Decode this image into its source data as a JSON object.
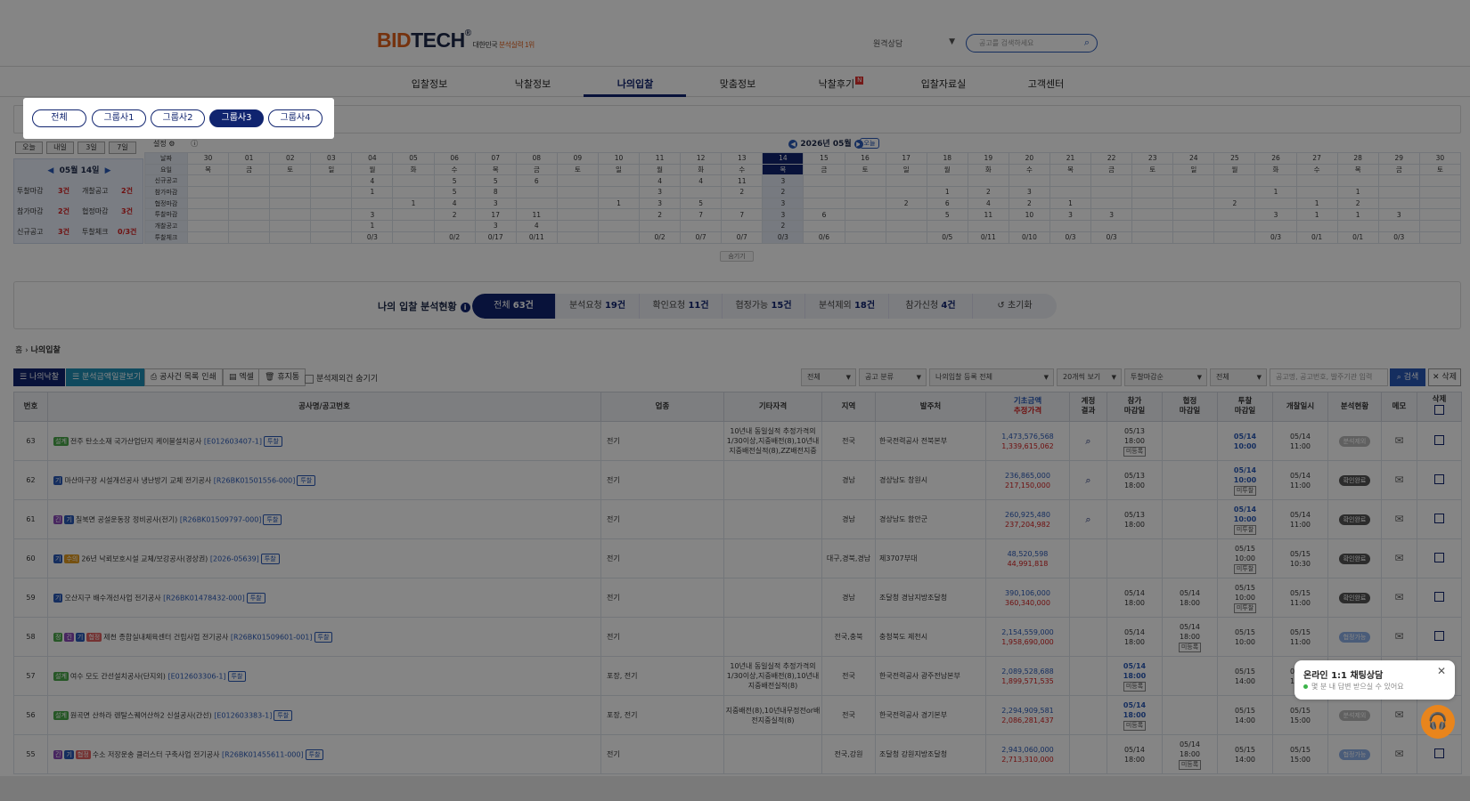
{
  "header": {
    "logo_bid": "BID",
    "logo_tech": "TECH",
    "logo_reg": "®",
    "slogan_prefix": "대한민국",
    "slogan_highlight": "분석실력 1위",
    "remote": "원격상담",
    "search_placeholder": "공고를 검색하세요"
  },
  "nav": [
    "입찰정보",
    "낙찰정보",
    "나의입찰",
    "맞춤정보",
    "낙찰후기",
    "입찰자료실",
    "고객센터"
  ],
  "nav_new_badge": "N",
  "groups": [
    "전체",
    "그룹사1",
    "그룹사2",
    "그룹사3",
    "그룹사4"
  ],
  "quick": [
    "오늘",
    "내일",
    "3일",
    "7일"
  ],
  "left_panel": {
    "date": "05월 14일",
    "rows": [
      {
        "a": "투찰마감",
        "av": "3건",
        "b": "개찰공고",
        "bv": "2건"
      },
      {
        "a": "참가마감",
        "av": "2건",
        "b": "협정마감",
        "bv": "3건"
      },
      {
        "a": "신규공고",
        "av": "3건",
        "b": "투찰체크",
        "bv": "0/3건"
      }
    ]
  },
  "calendar": {
    "setting": "설정",
    "month": "2026년 05월",
    "today_btn": "오늘",
    "row_labels": [
      "날짜",
      "요일",
      "신규공고",
      "참가마감",
      "협정마감",
      "투찰마감",
      "개찰공고",
      "투찰체크"
    ],
    "days": [
      "30",
      "01",
      "02",
      "03",
      "04",
      "05",
      "06",
      "07",
      "08",
      "09",
      "10",
      "11",
      "12",
      "13",
      "14",
      "15",
      "16",
      "17",
      "18",
      "19",
      "20",
      "21",
      "22",
      "23",
      "24",
      "25",
      "26",
      "27",
      "28",
      "29",
      "30"
    ],
    "weekdays": [
      "목",
      "금",
      "토",
      "일",
      "월",
      "화",
      "수",
      "목",
      "금",
      "토",
      "일",
      "월",
      "화",
      "수",
      "목",
      "금",
      "토",
      "일",
      "월",
      "화",
      "수",
      "목",
      "금",
      "토",
      "일",
      "월",
      "화",
      "수",
      "목",
      "금",
      "토"
    ],
    "new": [
      "",
      "",
      "",
      "",
      "4",
      "",
      "5",
      "5",
      "6",
      "",
      "",
      "4",
      "4",
      "11",
      "3",
      "",
      "",
      "",
      "",
      "",
      "",
      "",
      "",
      "",
      "",
      "",
      "",
      "",
      "",
      "",
      ""
    ],
    "join": [
      "",
      "",
      "",
      "",
      "1",
      "",
      "5",
      "8",
      "",
      "",
      "",
      "3",
      "",
      "2",
      "2",
      "",
      "",
      "",
      "1",
      "2",
      "3",
      "",
      "",
      "",
      "",
      "",
      "1",
      "",
      "1",
      "",
      ""
    ],
    "agree": [
      "",
      "",
      "",
      "",
      "",
      "1",
      "4",
      "3",
      "",
      "",
      "1",
      "3",
      "5",
      "",
      "3",
      "",
      "",
      "2",
      "6",
      "4",
      "2",
      "1",
      "",
      "",
      "",
      "2",
      "",
      "1",
      "2",
      "",
      ""
    ],
    "bid": [
      "",
      "",
      "",
      "",
      "3",
      "",
      "2",
      "17",
      "11",
      "",
      "",
      "2",
      "7",
      "7",
      "3",
      "6",
      "",
      "",
      "5",
      "11",
      "10",
      "3",
      "3",
      "",
      "",
      "",
      "3",
      "1",
      "1",
      "3",
      ""
    ],
    "open": [
      "",
      "",
      "",
      "",
      "1",
      "",
      "",
      "3",
      "4",
      "",
      "",
      "",
      "",
      "",
      "2",
      "",
      "",
      "",
      "",
      "",
      "",
      "",
      "",
      "",
      "",
      "",
      "",
      "",
      "",
      "",
      ""
    ],
    "check": [
      "",
      "",
      "",
      "",
      "0/3",
      "",
      "0/2",
      "0/17",
      "0/11",
      "",
      "",
      "0/2",
      "0/7",
      "0/7",
      "0/3",
      "0/6",
      "",
      "",
      "0/5",
      "0/11",
      "0/10",
      "0/3",
      "0/3",
      "",
      "",
      "",
      "0/3",
      "0/1",
      "0/1",
      "0/3",
      ""
    ],
    "collapse": "숨기기"
  },
  "summary": {
    "title": "나의 입찰 분석현황",
    "tabs": [
      {
        "label": "전체",
        "count": "63건"
      },
      {
        "label": "분석요청",
        "count": "19건"
      },
      {
        "label": "확인요청",
        "count": "11건"
      },
      {
        "label": "협정가능",
        "count": "15건"
      },
      {
        "label": "분석제외",
        "count": "18건"
      },
      {
        "label": "참가신청",
        "count": "4건"
      }
    ],
    "reset": "초기화"
  },
  "breadcrumb": {
    "home": "홈",
    "current": "나의입찰"
  },
  "toolbar": {
    "my_bids": "나의낙찰",
    "analysis": "분석금액일괄보기",
    "print": "공사건 목록 인쇄",
    "excel": "엑셀",
    "trash": "휴지통",
    "hide": "분석제외건 숨기기",
    "filters": [
      "전체",
      "공고 분류",
      "나의입찰 등록 전체",
      "20개씩 보기",
      "투찰마감순",
      "전체"
    ],
    "keyword_placeholder": "공고명, 공고번호, 발주기관 입력",
    "search": "검색",
    "delete": "삭제"
  },
  "table": {
    "headers": {
      "no": "번호",
      "name": "공사명/공고번호",
      "industry": "업종",
      "qual": "기타자격",
      "region": "지역",
      "client": "발주처",
      "price1": "기초금액",
      "price2": "추정가격",
      "calc1": "계정",
      "calc2": "결과",
      "join1": "참가",
      "join2": "마감일",
      "agree1": "협정",
      "agree2": "마감일",
      "bid1": "투찰",
      "bid2": "마감일",
      "open": "개찰일시",
      "status": "분석현황",
      "memo": "메모",
      "del": "삭제"
    },
    "rows": [
      {
        "no": "63",
        "tags": [
          [
            "설계",
            "green"
          ]
        ],
        "title": "전주 탄소소재 국가산업단지 케이블설치공사",
        "code": "[E012603407-1]",
        "industry": "전기",
        "qual": "10년내 동일실적 추정가격의 1/30이상,지중배전(8),10년내지중배전실적(8),ZZ배전지중",
        "region": "전국",
        "client": "한국전력공사 전북본부",
        "p1": "1,473,576,568",
        "p2": "1,339,615,062",
        "calc": true,
        "jd": "05/13",
        "jt": "18:00",
        "jr": "미등록",
        "ad": "",
        "at": "",
        "ar": "",
        "bd": "05/14",
        "bt": "10:00",
        "br": "",
        "od": "05/14",
        "ot": "11:00",
        "status": "분석제외",
        "st": "light"
      },
      {
        "no": "62",
        "tags": [
          [
            "기",
            "blue"
          ]
        ],
        "title": "마산마구장 시설개선공사 냉난방기 교체 전기공사",
        "code": "[R26BK01501556-000]",
        "industry": "전기",
        "qual": "",
        "region": "경남",
        "client": "경상남도 창원시",
        "p1": "236,865,000",
        "p2": "217,150,000",
        "calc": true,
        "jd": "05/13",
        "jt": "18:00",
        "jr": "",
        "ad": "",
        "at": "",
        "ar": "",
        "bd": "05/14",
        "bt": "10:00",
        "br": "미투찰",
        "od": "05/14",
        "ot": "11:00",
        "status": "확인완료",
        "st": "dark"
      },
      {
        "no": "61",
        "tags": [
          [
            "긴",
            "purple"
          ],
          [
            "기",
            "blue"
          ]
        ],
        "title": "칠북면 공설운동장 정비공사(전기)",
        "code": "[R26BK01509797-000]",
        "industry": "전기",
        "qual": "",
        "region": "경남",
        "client": "경상남도 함안군",
        "p1": "260,925,480",
        "p2": "237,204,982",
        "calc": true,
        "jd": "05/13",
        "jt": "18:00",
        "jr": "",
        "ad": "",
        "at": "",
        "ar": "",
        "bd": "05/14",
        "bt": "10:00",
        "br": "미투찰",
        "od": "05/14",
        "ot": "11:00",
        "status": "확인완료",
        "st": "dark"
      },
      {
        "no": "60",
        "tags": [
          [
            "기",
            "blue"
          ],
          [
            "수의",
            "orange"
          ]
        ],
        "title": "26년 낙뢰보호시설 교체/보강공사(경상권)",
        "code": "[2026-05639]",
        "industry": "전기",
        "qual": "",
        "region": "대구,경북,경남",
        "client": "제3707부대",
        "p1": "48,520,598",
        "p2": "44,991,818",
        "calc": false,
        "jd": "",
        "jt": "",
        "jr": "",
        "ad": "",
        "at": "",
        "ar": "",
        "bd": "05/15",
        "bt": "10:00",
        "br": "미투찰",
        "od": "05/15",
        "ot": "10:30",
        "status": "확인완료",
        "st": "dark"
      },
      {
        "no": "59",
        "tags": [
          [
            "기",
            "blue"
          ]
        ],
        "title": "오산지구 배수개선사업 전기공사",
        "code": "[R26BK01478432-000]",
        "industry": "전기",
        "qual": "",
        "region": "경남",
        "client": "조달청 경남지방조달청",
        "p1": "390,106,000",
        "p2": "360,340,000",
        "calc": false,
        "jd": "05/14",
        "jt": "18:00",
        "jr": "",
        "ad": "05/14",
        "at": "18:00",
        "ar": "",
        "bd": "05/15",
        "bt": "10:00",
        "br": "미투찰",
        "od": "05/15",
        "ot": "11:00",
        "status": "확인완료",
        "st": "dark"
      },
      {
        "no": "58",
        "tags": [
          [
            "정",
            "green"
          ],
          [
            "긴",
            "purple"
          ],
          [
            "기",
            "blue"
          ],
          [
            "협정",
            "red"
          ]
        ],
        "title": "제천 종합실내체육센터 건립사업 전기공사",
        "code": "[R26BK01509601-001]",
        "industry": "전기",
        "qual": "",
        "region": "전국,충북",
        "client": "충청북도 제천시",
        "p1": "2,154,559,000",
        "p2": "1,958,690,000",
        "calc": false,
        "jd": "05/14",
        "jt": "18:00",
        "jr": "",
        "ad": "05/14",
        "at": "18:00",
        "ar": "미등록",
        "bd": "05/15",
        "bt": "10:00",
        "br": "",
        "od": "05/15",
        "ot": "11:00",
        "status": "협정가능",
        "st": "blue"
      },
      {
        "no": "57",
        "tags": [
          [
            "설계",
            "green"
          ]
        ],
        "title": "여수 모도 간선설치공사(단지외)",
        "code": "[E012603306-1]",
        "industry": "포장, 전기",
        "qual": "10년내 동일실적 추정가격의 1/30이상,지중배전(8),10년내지중배전실적(8)",
        "region": "전국",
        "client": "한국전력공사 광주전남본부",
        "p1": "2,089,528,688",
        "p2": "1,899,571,535",
        "calc": false,
        "jd": "05/14",
        "jt": "18:00",
        "jr": "미등록",
        "ad": "",
        "at": "",
        "ar": "",
        "bd": "05/15",
        "bt": "14:00",
        "br": "",
        "od": "05/15",
        "ot": "14:00",
        "status": "",
        "st": ""
      },
      {
        "no": "56",
        "tags": [
          [
            "설계",
            "green"
          ]
        ],
        "title": "원곡면 산하라 렌탈스퀘어산하2 신설공사(간선)",
        "code": "[E012603383-1]",
        "industry": "포장, 전기",
        "qual": "지중배전(8),10년내무정전or배전지중실적(8)",
        "region": "전국",
        "client": "한국전력공사 경기본부",
        "p1": "2,294,909,581",
        "p2": "2,086,281,437",
        "calc": false,
        "jd": "05/14",
        "jt": "18:00",
        "jr": "미등록",
        "ad": "",
        "at": "",
        "ar": "",
        "bd": "05/15",
        "bt": "14:00",
        "br": "",
        "od": "05/15",
        "ot": "15:00",
        "status": "분석제외",
        "st": "light"
      },
      {
        "no": "55",
        "tags": [
          [
            "긴",
            "purple"
          ],
          [
            "기",
            "blue"
          ],
          [
            "협정",
            "red"
          ]
        ],
        "title": "수소 저장운송 클러스터 구축사업 전기공사",
        "code": "[R26BK01455611-000]",
        "industry": "전기",
        "qual": "",
        "region": "전국,강원",
        "client": "조달청 강원지방조달청",
        "p1": "2,943,060,000",
        "p2": "2,713,310,000",
        "calc": false,
        "jd": "05/14",
        "jt": "18:00",
        "jr": "",
        "ad": "05/14",
        "at": "18:00",
        "ar": "미등록",
        "bd": "05/15",
        "bt": "14:00",
        "br": "",
        "od": "05/15",
        "ot": "15:00",
        "status": "협정가능",
        "st": "blue"
      }
    ],
    "tu_label": "투찰"
  },
  "chat": {
    "title": "온라인 1:1 채팅상담",
    "sub": "몇 분 내 답변 받으실 수 있어요"
  }
}
